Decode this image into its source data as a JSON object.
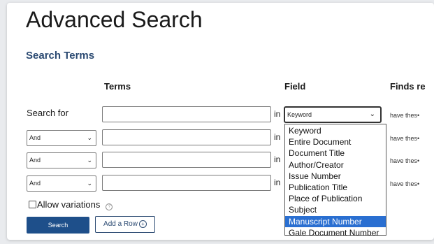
{
  "page": {
    "title": "Advanced Search",
    "section_heading": "Search Terms"
  },
  "columns": {
    "terms": "Terms",
    "field": "Field",
    "finds": "Finds re"
  },
  "rows": [
    {
      "label": "Search for",
      "operator": "",
      "value": "",
      "in": "in",
      "field": "Keyword",
      "finds": "have thes•"
    },
    {
      "label": "",
      "operator": "And",
      "value": "",
      "in": "in",
      "field": "",
      "finds": "have thes•"
    },
    {
      "label": "",
      "operator": "And",
      "value": "",
      "in": "in",
      "field": "",
      "finds": "have thes•"
    },
    {
      "label": "",
      "operator": "And",
      "value": "",
      "in": "in",
      "field": "",
      "finds": "have thes•"
    }
  ],
  "field_dropdown": {
    "selected_index": 8,
    "options": [
      "Keyword",
      "Entire Document",
      "Document Title",
      "Author/Creator",
      "Issue Number",
      "Publication Title",
      "Place of Publication",
      "Subject",
      "Manuscript Number",
      "Gale Document Number"
    ]
  },
  "options": {
    "allow_variations_label": "Allow variations",
    "allow_variations_checked": false,
    "help_icon": "help-circle-icon"
  },
  "buttons": {
    "search_label": "Search",
    "add_row_label": "Add a Row",
    "add_row_icon": "plus-circle-icon"
  },
  "colors": {
    "accent": "#1e4f8a",
    "heading": "#2b4a72",
    "selected_option": "#2a6fd1"
  }
}
